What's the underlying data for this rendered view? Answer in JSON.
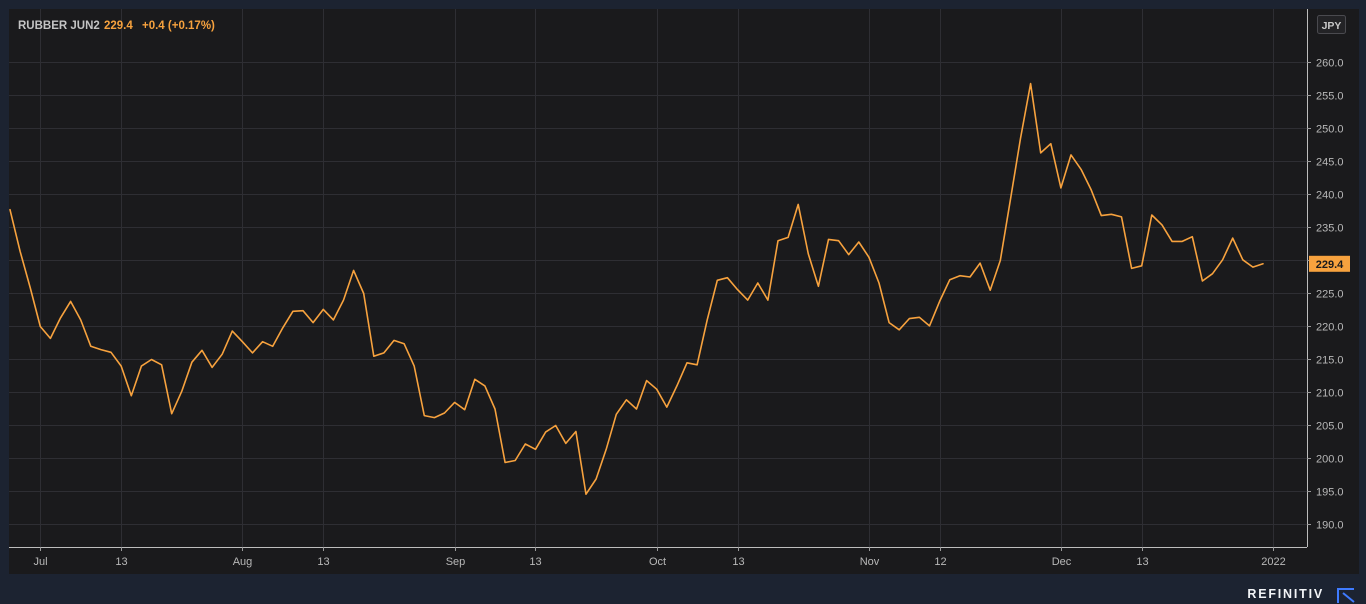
{
  "legend": {
    "symbol": "RUBBER JUN2",
    "last": "229.4",
    "change": "+0.4 (+0.17%)"
  },
  "currency_label": "JPY",
  "brand": "REFINITIV",
  "colors": {
    "background": "#1c2331",
    "plot_background": "#1a1a1c",
    "grid": "#2e2e33",
    "line": "#f7a23e",
    "axis_text": "#b8b8b8",
    "brand_accent": "#3f7bff"
  },
  "chart_data": {
    "type": "line",
    "title": "RUBBER JUN2",
    "xlabel": "",
    "ylabel": "",
    "ylim": [
      186.5,
      268.0
    ],
    "yticks": [
      190.0,
      195.0,
      200.0,
      205.0,
      210.0,
      215.0,
      220.0,
      225.0,
      230.0,
      235.0,
      240.0,
      245.0,
      250.0,
      255.0,
      260.0
    ],
    "y_axis_position": "right",
    "grid": true,
    "x_tick_labels": [
      "Jul",
      "13",
      "Aug",
      "13",
      "Sep",
      "13",
      "Oct",
      "13",
      "Nov",
      "12",
      "Dec",
      "13",
      "2022"
    ],
    "x_tick_positions": [
      3,
      11,
      23,
      31,
      44,
      52,
      64,
      72,
      85,
      92,
      104,
      112,
      125
    ],
    "last_value_label": "229.4",
    "values": [
      237.6,
      231.3,
      225.8,
      219.9,
      218.1,
      221.2,
      223.7,
      220.9,
      216.9,
      216.4,
      216.0,
      213.9,
      209.4,
      213.9,
      214.9,
      214.1,
      206.7,
      210.1,
      214.5,
      216.3,
      213.7,
      215.7,
      219.2,
      217.6,
      215.9,
      217.6,
      216.9,
      219.7,
      222.2,
      222.3,
      220.5,
      222.5,
      220.9,
      223.9,
      228.4,
      224.9,
      215.4,
      215.9,
      217.8,
      217.3,
      213.9,
      206.4,
      206.1,
      206.8,
      208.4,
      207.3,
      211.9,
      210.9,
      207.4,
      199.3,
      199.6,
      202.1,
      201.3,
      203.9,
      204.9,
      202.2,
      204.0,
      194.5,
      196.8,
      201.3,
      206.6,
      208.8,
      207.4,
      211.7,
      210.4,
      207.7,
      210.9,
      214.4,
      214.1,
      220.9,
      226.9,
      227.3,
      225.5,
      223.9,
      226.5,
      223.9,
      232.9,
      233.4,
      238.4,
      230.9,
      226.0,
      233.1,
      232.9,
      230.8,
      232.7,
      230.4,
      226.5,
      220.5,
      219.4,
      221.1,
      221.3,
      220.0,
      223.7,
      227.0,
      227.6,
      227.4,
      229.5,
      225.4,
      229.9,
      239.1,
      248.4,
      256.7,
      246.2,
      247.6,
      240.9,
      245.9,
      243.7,
      240.6,
      236.7,
      236.9,
      236.5,
      228.7,
      229.1,
      236.8,
      235.3,
      232.8,
      232.8,
      233.5,
      226.8,
      227.9,
      230.0,
      233.3,
      230.0,
      228.9,
      229.4
    ]
  }
}
